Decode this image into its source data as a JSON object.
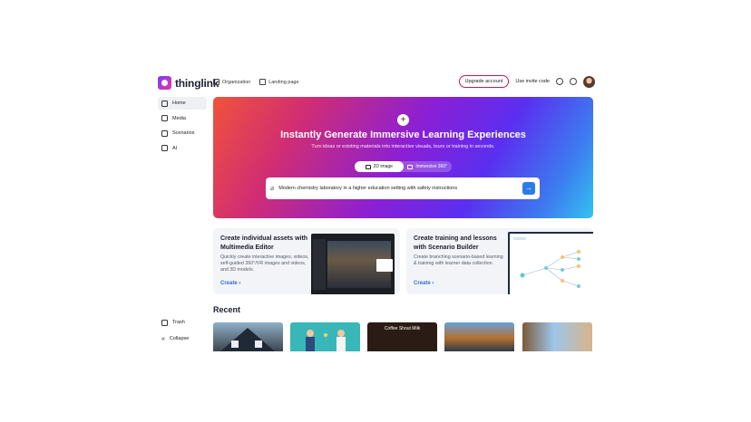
{
  "app": {
    "logo_text": "thinglink"
  },
  "topnav": {
    "items": [
      {
        "label": "Organization",
        "icon": "organization-icon"
      },
      {
        "label": "Landing page",
        "icon": "landing-page-icon"
      }
    ],
    "upgrade_label": "Upgrade account",
    "invite_label": "Use invite code",
    "icons": [
      "graduation-cap-icon",
      "gear-icon",
      "avatar"
    ]
  },
  "sidebar": {
    "items": [
      {
        "label": "Home",
        "icon": "home-icon",
        "active": true
      },
      {
        "label": "Media",
        "icon": "media-icon",
        "active": false
      },
      {
        "label": "Scenarios",
        "icon": "scenarios-icon",
        "active": false
      },
      {
        "label": "AI",
        "icon": "ai-icon",
        "active": false
      }
    ],
    "trash_label": "Trash",
    "collapse_label": "Collapse"
  },
  "hero": {
    "title": "Instantly Generate Immersive Learning Experiences",
    "subtitle": "Turn ideas or existing materials into interactive visuals, tours or training in seconds.",
    "toggle": [
      {
        "label": "2D image",
        "active": true
      },
      {
        "label": "Immersive 360°",
        "active": false
      }
    ],
    "prompt_value": "Modern chemistry laboratory in a higher education setting with safety instructions"
  },
  "cards": [
    {
      "title": "Create individual assets with Multimedia Editor",
      "description": "Quickly create interactive images, videos, self-guided 360°/VR images and videos, and 3D models.",
      "cta": "Create"
    },
    {
      "title": "Create training and lessons with Scenario Builder",
      "description": "Create branching scenario-based learning & training with learner data collection.",
      "cta": "Create"
    }
  ],
  "recent": {
    "title": "Recent",
    "items": [
      {
        "thumb": "house-photo"
      },
      {
        "thumb": "illustration-people"
      },
      {
        "thumb": "coffee-menu",
        "caption": "Coffee Shout Milk"
      },
      {
        "thumb": "factory-worker"
      },
      {
        "thumb": "city-street"
      }
    ]
  }
}
